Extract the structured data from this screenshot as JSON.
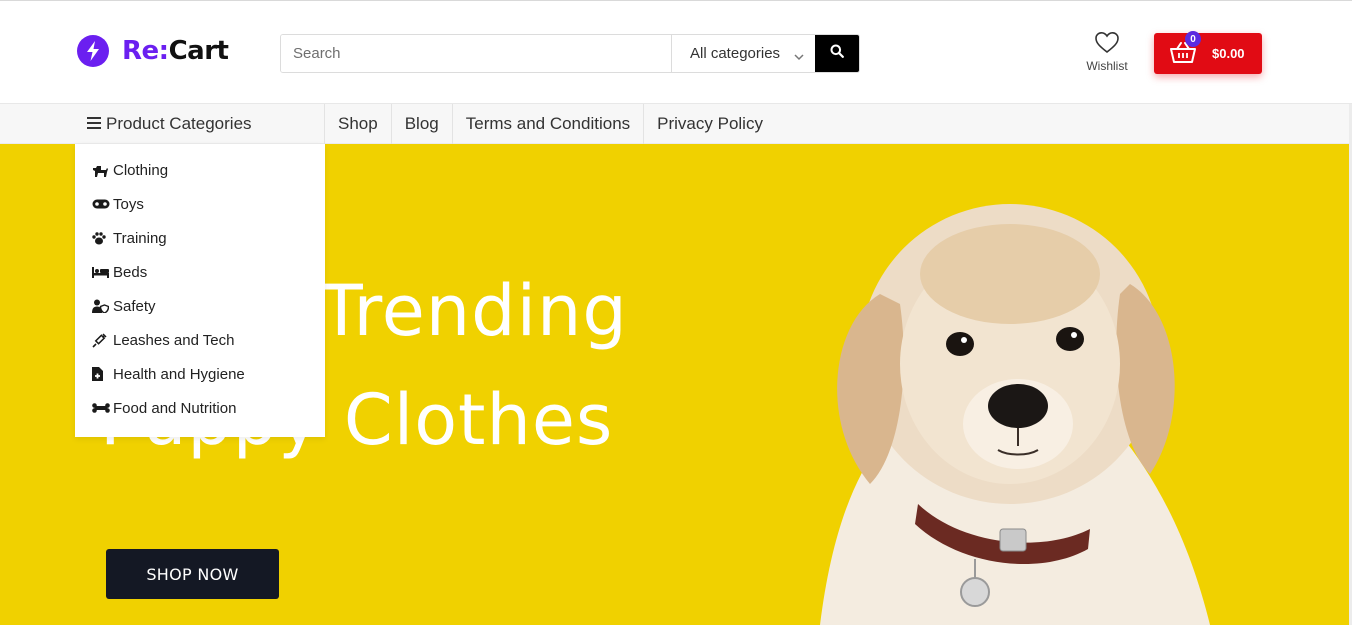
{
  "brand": {
    "name_accent": "Re:",
    "name_rest": "Cart",
    "accent_color": "#6b1ff0"
  },
  "search": {
    "placeholder": "Search",
    "value": "",
    "category_selected": "All categories"
  },
  "header_actions": {
    "wishlist_label": "Wishlist",
    "cart_count": "0",
    "cart_total": "$0.00",
    "cart_color": "#e10b14"
  },
  "nav": {
    "categories_toggle": "Product Categories",
    "links": [
      "Shop",
      "Blog",
      "Terms and Conditions",
      "Privacy Policy"
    ]
  },
  "categories": [
    {
      "label": "Clothing",
      "icon": "dog-icon"
    },
    {
      "label": "Toys",
      "icon": "gamepad-icon"
    },
    {
      "label": "Training",
      "icon": "paw-icon"
    },
    {
      "label": "Beds",
      "icon": "bed-icon"
    },
    {
      "label": "Safety",
      "icon": "user-shield-icon"
    },
    {
      "label": "Leashes and Tech",
      "icon": "syringe-icon"
    },
    {
      "label": "Health and Hygiene",
      "icon": "medical-file-icon"
    },
    {
      "label": "Food and Nutrition",
      "icon": "bone-icon"
    }
  ],
  "hero": {
    "title_line1": "Trending",
    "title_line2": "Puppy Clothes",
    "cta_label": "SHOP NOW",
    "background_color": "#f0d100"
  }
}
